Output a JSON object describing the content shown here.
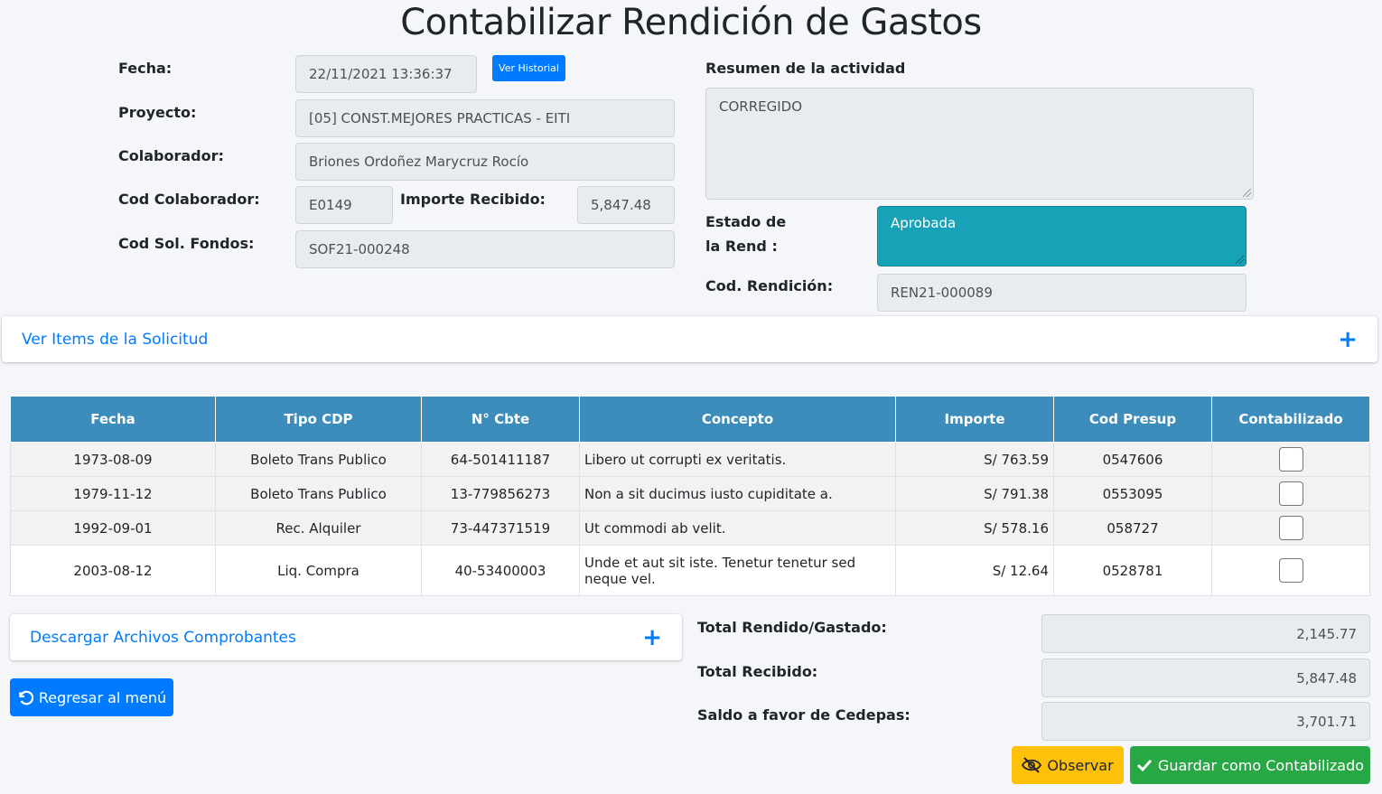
{
  "title": "Contabilizar Rendición de Gastos",
  "form": {
    "fecha_label": "Fecha:",
    "fecha_value": "22/11/2021 13:36:37",
    "ver_historial": "Ver Historial",
    "proyecto_label": "Proyecto:",
    "proyecto_value": "[05] CONST.MEJORES PRACTICAS - EITI",
    "colaborador_label": "Colaborador:",
    "colaborador_value": "Briones Ordoñez Marycruz Rocío",
    "cod_colaborador_label": "Cod Colaborador:",
    "cod_colaborador_value": "E0149",
    "importe_recibido_label": "Importe Recibido:",
    "importe_recibido_value": "5,847.48",
    "cod_sol_label": "Cod Sol. Fondos:",
    "cod_sol_value": "SOF21-000248",
    "resumen_label": "Resumen de la actividad",
    "resumen_value": "CORREGIDO",
    "estado_label_1": "Estado de",
    "estado_label_2": "la Rend :",
    "estado_value": "Aprobada",
    "cod_rendicion_label": "Cod. Rendición:",
    "cod_rendicion_value": "REN21-000089"
  },
  "ver_items": "Ver Items de la Solicitud",
  "table": {
    "headers": [
      "Fecha",
      "Tipo CDP",
      "N° Cbte",
      "Concepto",
      "Importe",
      "Cod Presup",
      "Contabilizado"
    ],
    "rows": [
      {
        "fecha": "1973-08-09",
        "tipo": "Boleto Trans Publico",
        "cbte": "64-501411187",
        "concepto": "Libero ut corrupti ex veritatis.",
        "importe": "S/ 763.59",
        "presup": "0547606",
        "checked": false
      },
      {
        "fecha": "1979-11-12",
        "tipo": "Boleto Trans Publico",
        "cbte": "13-779856273",
        "concepto": "Non a sit ducimus iusto cupiditate a.",
        "importe": "S/ 791.38",
        "presup": "0553095",
        "checked": false
      },
      {
        "fecha": "1992-09-01",
        "tipo": "Rec. Alquiler",
        "cbte": "73-447371519",
        "concepto": "Ut commodi ab velit.",
        "importe": "S/ 578.16",
        "presup": "058727",
        "checked": false
      },
      {
        "fecha": "2003-08-12",
        "tipo": "Liq. Compra",
        "cbte": "40-53400003",
        "concepto": "Unde et aut sit iste. Tenetur tenetur sed neque vel.",
        "importe": "S/ 12.64",
        "presup": "0528781",
        "checked": false
      }
    ]
  },
  "descargar": "Descargar Archivos Comprobantes",
  "regresar": "Regresar al menú",
  "totals": {
    "rendido_label": "Total Rendido/Gastado:",
    "rendido_value": "2,145.77",
    "recibido_label": "Total Recibido:",
    "recibido_value": "5,847.48",
    "saldo_label": "Saldo a favor de Cedepas:",
    "saldo_value": "3,701.71"
  },
  "buttons": {
    "observar": "Observar",
    "guardar": "Guardar como Contabilizado"
  },
  "colors": {
    "primary": "#007bff",
    "info": "#17a2b8",
    "header": "#3c8dbc",
    "warning": "#ffc107",
    "success": "#28a745"
  },
  "icons": [
    "undo-icon",
    "eye-slash-icon",
    "check-icon",
    "plus-icon"
  ]
}
